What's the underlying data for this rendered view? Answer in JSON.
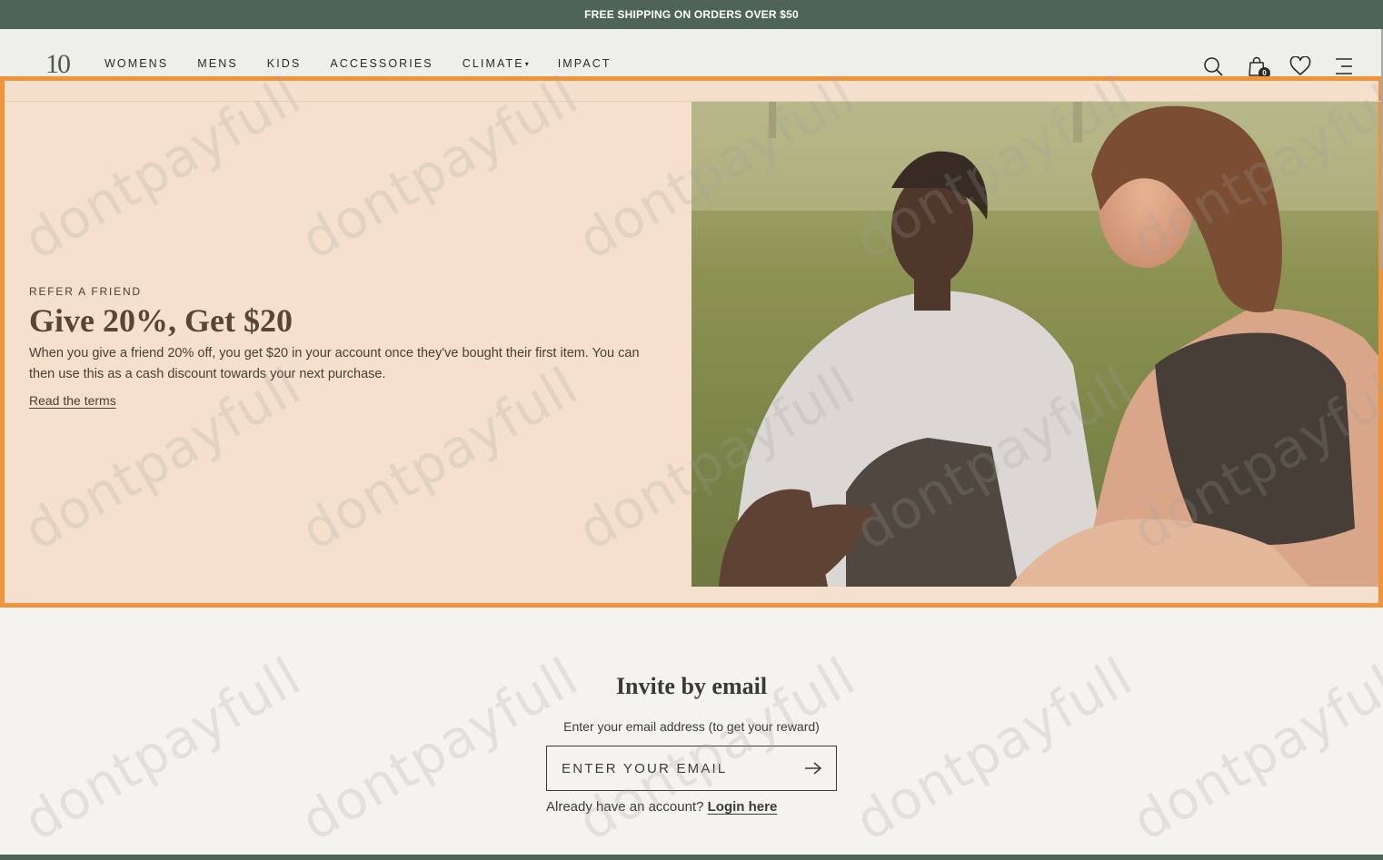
{
  "promo": {
    "text": "FREE SHIPPING ON ORDERS OVER $50"
  },
  "header": {
    "logo": "10",
    "nav": [
      {
        "label": "WOMENS"
      },
      {
        "label": "MENS"
      },
      {
        "label": "KIDS"
      },
      {
        "label": "ACCESSORIES"
      },
      {
        "label": "CLIMATE",
        "caret": "▾"
      },
      {
        "label": "IMPACT"
      }
    ],
    "icons": {
      "search": "search-icon",
      "cart": "shopping-bag-icon",
      "wishlist": "heart-icon",
      "menu": "hamburger-menu-icon"
    },
    "cart_count": "0"
  },
  "hero": {
    "eyebrow": "REFER A FRIEND",
    "title": "Give 20%, Get $20",
    "description": "When you give a friend 20% off, you get $20 in your account once they've bought their first item. You can then use this as a cash discount towards your next purchase.",
    "terms_link": "Read the terms"
  },
  "invite": {
    "title": "Invite by email",
    "subtitle": "Enter your email address (to get your reward)",
    "email_placeholder": "ENTER YOUR EMAIL",
    "login_prompt": "Already have an account?",
    "login_link": "Login here"
  },
  "watermark": "dontpayfull",
  "colors": {
    "promo_bar": "#4e6459",
    "hero_background": "#f4e0cc",
    "highlight_border": "#f0933d",
    "page_background": "#f4f3f0"
  }
}
